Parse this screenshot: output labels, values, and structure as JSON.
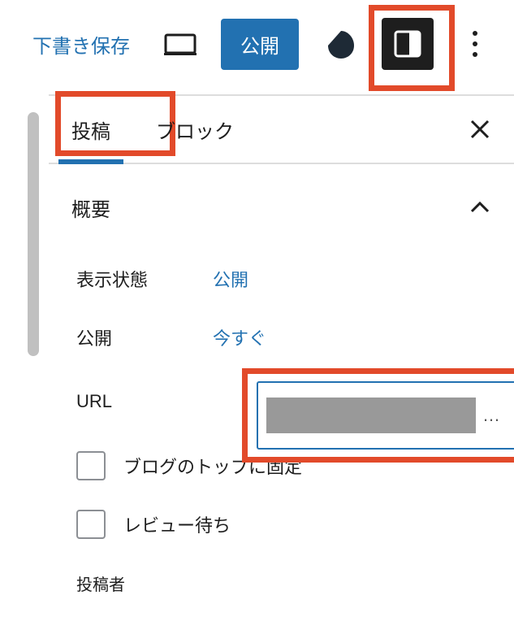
{
  "toolbar": {
    "save_draft": "下書き保存",
    "publish": "公開"
  },
  "tabs": {
    "post": "投稿",
    "block": "ブロック"
  },
  "section": {
    "title": "概要"
  },
  "status": {
    "visibility_label": "表示状態",
    "visibility_value": "公開",
    "publish_label": "公開",
    "publish_value": "今すぐ",
    "url_label": "URL",
    "url_ellipsis": "…"
  },
  "checkboxes": {
    "sticky": "ブログのトップに固定",
    "pending": "レビュー待ち"
  },
  "author": {
    "label": "投稿者"
  },
  "colors": {
    "accent": "#2271b1",
    "highlight": "#e24a2a"
  }
}
